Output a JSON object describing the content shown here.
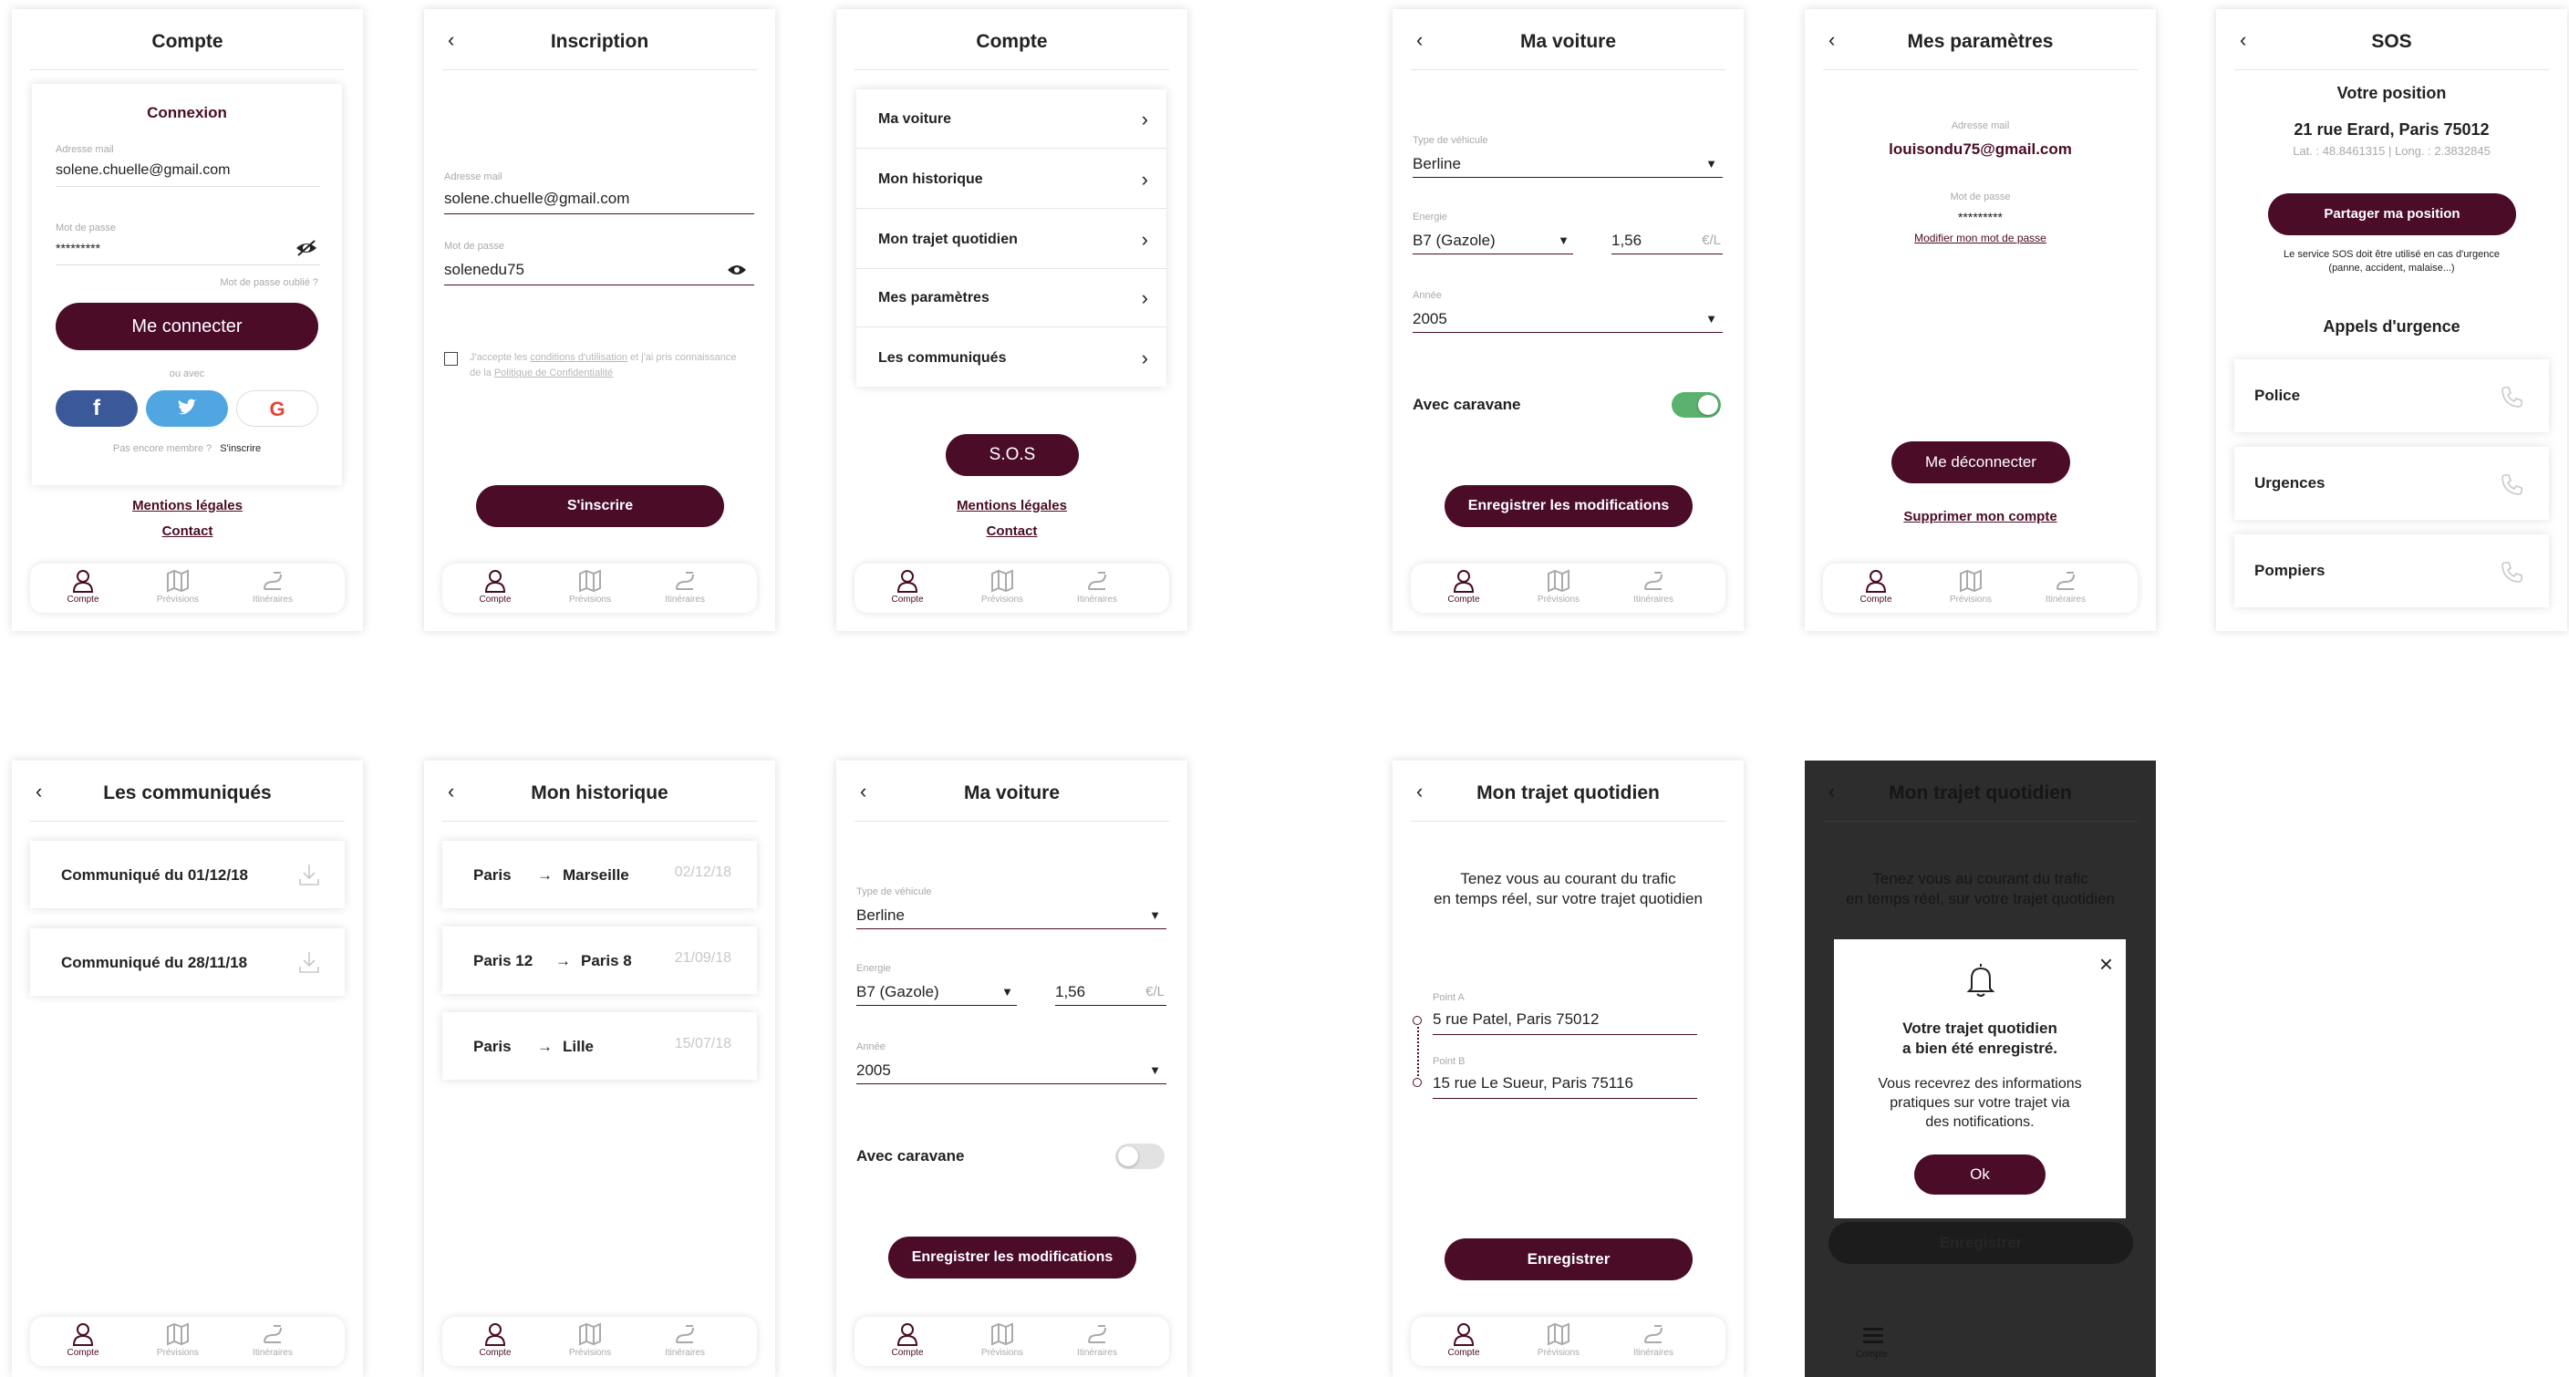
{
  "colors": {
    "brand": "#4a0c26",
    "toggle_on": "#5bb26f",
    "muted": "#a9a9a9",
    "facebook": "#3b5998",
    "twitter": "#4fa6e0"
  },
  "tabbar": {
    "compte": "Compte",
    "previsions": "Prévisions",
    "itineraires": "Itinéraires"
  },
  "s1": {
    "title": "Compte",
    "card_title": "Connexion",
    "email_label": "Adresse mail",
    "email_value": "solene.chuelle@gmail.com",
    "pwd_label": "Mot de passe",
    "pwd_value": "*********",
    "forgot": "Mot de passe oublié ?",
    "login_btn": "Me connecter",
    "or_with": "ou avec",
    "not_member": "Pas encore membre ?",
    "signup_link": "S'inscrire",
    "legal": "Mentions légales",
    "contact": "Contact"
  },
  "s2": {
    "title": "Inscription",
    "email_label": "Adresse mail",
    "email_value": "solene.chuelle@gmail.com",
    "pwd_label": "Mot de passe",
    "pwd_value": "solenedu75",
    "terms_pre": "J'accepte les ",
    "terms_link": "conditions d'utilisation",
    "terms_mid": " et j'ai pris connaissance de la ",
    "terms_link2": "Politique de Confidentialité",
    "submit": "S'inscrire"
  },
  "s3": {
    "title": "Compte",
    "items": [
      "Ma voiture",
      "Mon historique",
      "Mon trajet quotidien",
      "Mes paramètres",
      "Les communiqués"
    ],
    "sos": "S.O.S",
    "legal": "Mentions légales",
    "contact": "Contact"
  },
  "s4": {
    "title": "Ma voiture",
    "type_label": "Type de véhicule",
    "type_value": "Berline",
    "energy_label": "Energie",
    "energy_value": "B7 (Gazole)",
    "price_value": "1,56",
    "price_unit": "€/L",
    "year_label": "Année",
    "year_value": "2005",
    "caravan": "Avec caravane",
    "caravan_on": true,
    "save": "Enregistrer les modifications"
  },
  "s5": {
    "title": "Mes paramètres",
    "email_label": "Adresse mail",
    "email_value": "louisondu75@gmail.com",
    "pwd_label": "Mot de passe",
    "pwd_value": "*********",
    "change_pwd": "Modifier mon mot de passe",
    "logout": "Me déconnecter",
    "delete": "Supprimer mon compte"
  },
  "s6": {
    "title": "SOS",
    "pos_title": "Votre position",
    "address": "21 rue Erard, Paris 75012",
    "coords": "Lat. : 48.8461315 | Long. : 2.3832845",
    "share": "Partager ma position",
    "note": "Le service SOS doit être utilisé en cas d'urgence (panne, accident, malaise...)",
    "calls_title": "Appels d'urgence",
    "calls": [
      "Police",
      "Urgences",
      "Pompiers"
    ]
  },
  "s7": {
    "title": "Les communiqués",
    "items": [
      "Communiqué du 01/12/18",
      "Communiqué du 28/11/18"
    ]
  },
  "s8": {
    "title": "Mon historique",
    "items": [
      {
        "from": "Paris",
        "to": "Marseille",
        "date": "02/12/18"
      },
      {
        "from": "Paris 12",
        "to": "Paris 8",
        "date": "21/09/18"
      },
      {
        "from": "Paris",
        "to": "Lille",
        "date": "15/07/18"
      }
    ]
  },
  "s9": {
    "title": "Ma voiture",
    "type_label": "Type de véhicule",
    "type_value": "Berline",
    "energy_label": "Energie",
    "energy_value": "B7 (Gazole)",
    "price_value": "1,56",
    "price_unit": "€/L",
    "year_label": "Année",
    "year_value": "2005",
    "caravan": "Avec caravane",
    "caravan_on": false,
    "save": "Enregistrer les modifications"
  },
  "s10": {
    "title": "Mon trajet quotidien",
    "intro1": "Tenez vous au courant du trafic",
    "intro2": "en temps réel, sur votre trajet quotidien",
    "a_label": "Point A",
    "a_value": "5 rue Patel, Paris 75012",
    "b_label": "Point B",
    "b_value": "15 rue Le Sueur, Paris 75116",
    "save": "Enregistrer"
  },
  "s11": {
    "title": "Mon trajet quotidien",
    "intro1": "Tenez vous au courant du trafic",
    "intro2": "en temps réel, sur votre trajet quotidien",
    "modal_title1": "Votre trajet quotidien",
    "modal_title2": "a bien été enregistré.",
    "modal_text1": "Vous recevrez des informations",
    "modal_text2": "pratiques sur votre trajet via",
    "modal_text3": "des notifications.",
    "ok": "Ok",
    "bg_button": "Enregistrer",
    "tab_label": "Compte"
  }
}
